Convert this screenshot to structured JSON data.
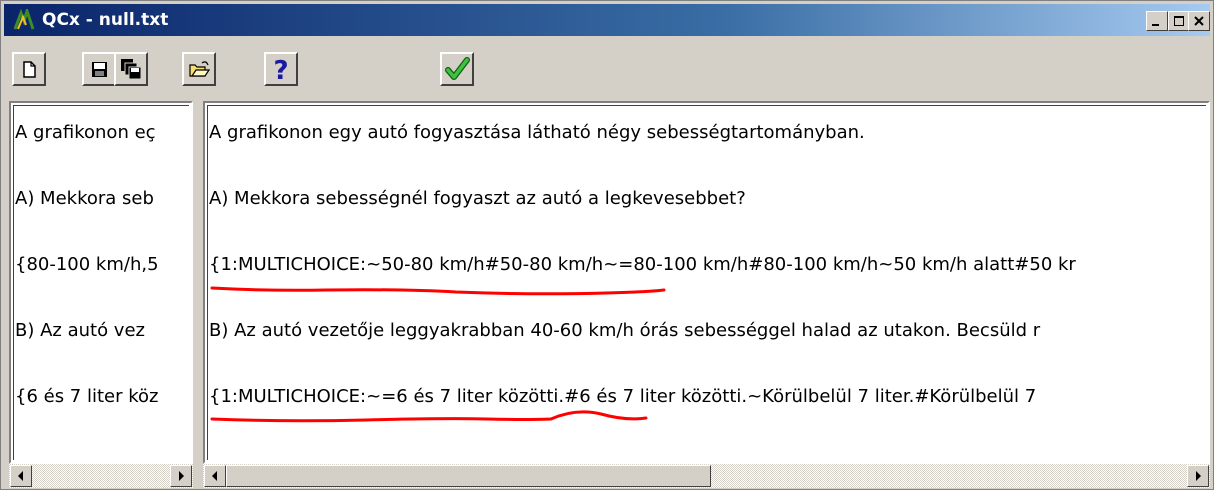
{
  "window": {
    "title": "QCx - null.txt",
    "controls": {
      "minimize_icon": "minimize-icon",
      "maximize_icon": "maximize-icon",
      "close_icon": "close-icon"
    }
  },
  "toolbar": {
    "buttons": [
      {
        "name": "new-file",
        "icon": "new-document-icon"
      },
      {
        "name": "save",
        "icon": "floppy-disk-icon"
      },
      {
        "name": "save-all",
        "icon": "multiple-floppy-icon"
      },
      {
        "name": "open",
        "icon": "open-folder-icon"
      },
      {
        "name": "help",
        "icon": "question-mark-icon",
        "label": "?"
      },
      {
        "name": "check",
        "icon": "green-checkmark-icon"
      }
    ]
  },
  "left_pane": {
    "lines": [
      "A grafikonon eç",
      "A) Mekkora seb",
      "{80-100 km/h,5",
      "B) Az autó vez",
      "{6 és 7 liter köz"
    ]
  },
  "right_pane": {
    "lines": [
      "A grafikonon egy autó fogyasztása látható négy sebességtartományban.",
      "A) Mekkora sebességnél fogyaszt az autó a legkevesebbet?",
      "{1:MULTICHOICE:~50-80 km/h#50-80 km/h~=80-100 km/h#80-100 km/h~50 km/h alatt#50 kr",
      "B) Az autó vezetője leggyakrabban 40-60 km/h órás sebességgel halad az utakon. Becsüld r",
      "{1:MULTICHOICE:~=6 és 7 liter közötti.#6 és 7 liter közötti.~Körülbelül 7 liter.#Körülbelül 7"
    ]
  },
  "colors": {
    "titlebar_start": "#0a246a",
    "titlebar_end": "#a6caf0",
    "annotation": "#ff0000",
    "help": "#1a1aa0",
    "check": "#20a020"
  }
}
